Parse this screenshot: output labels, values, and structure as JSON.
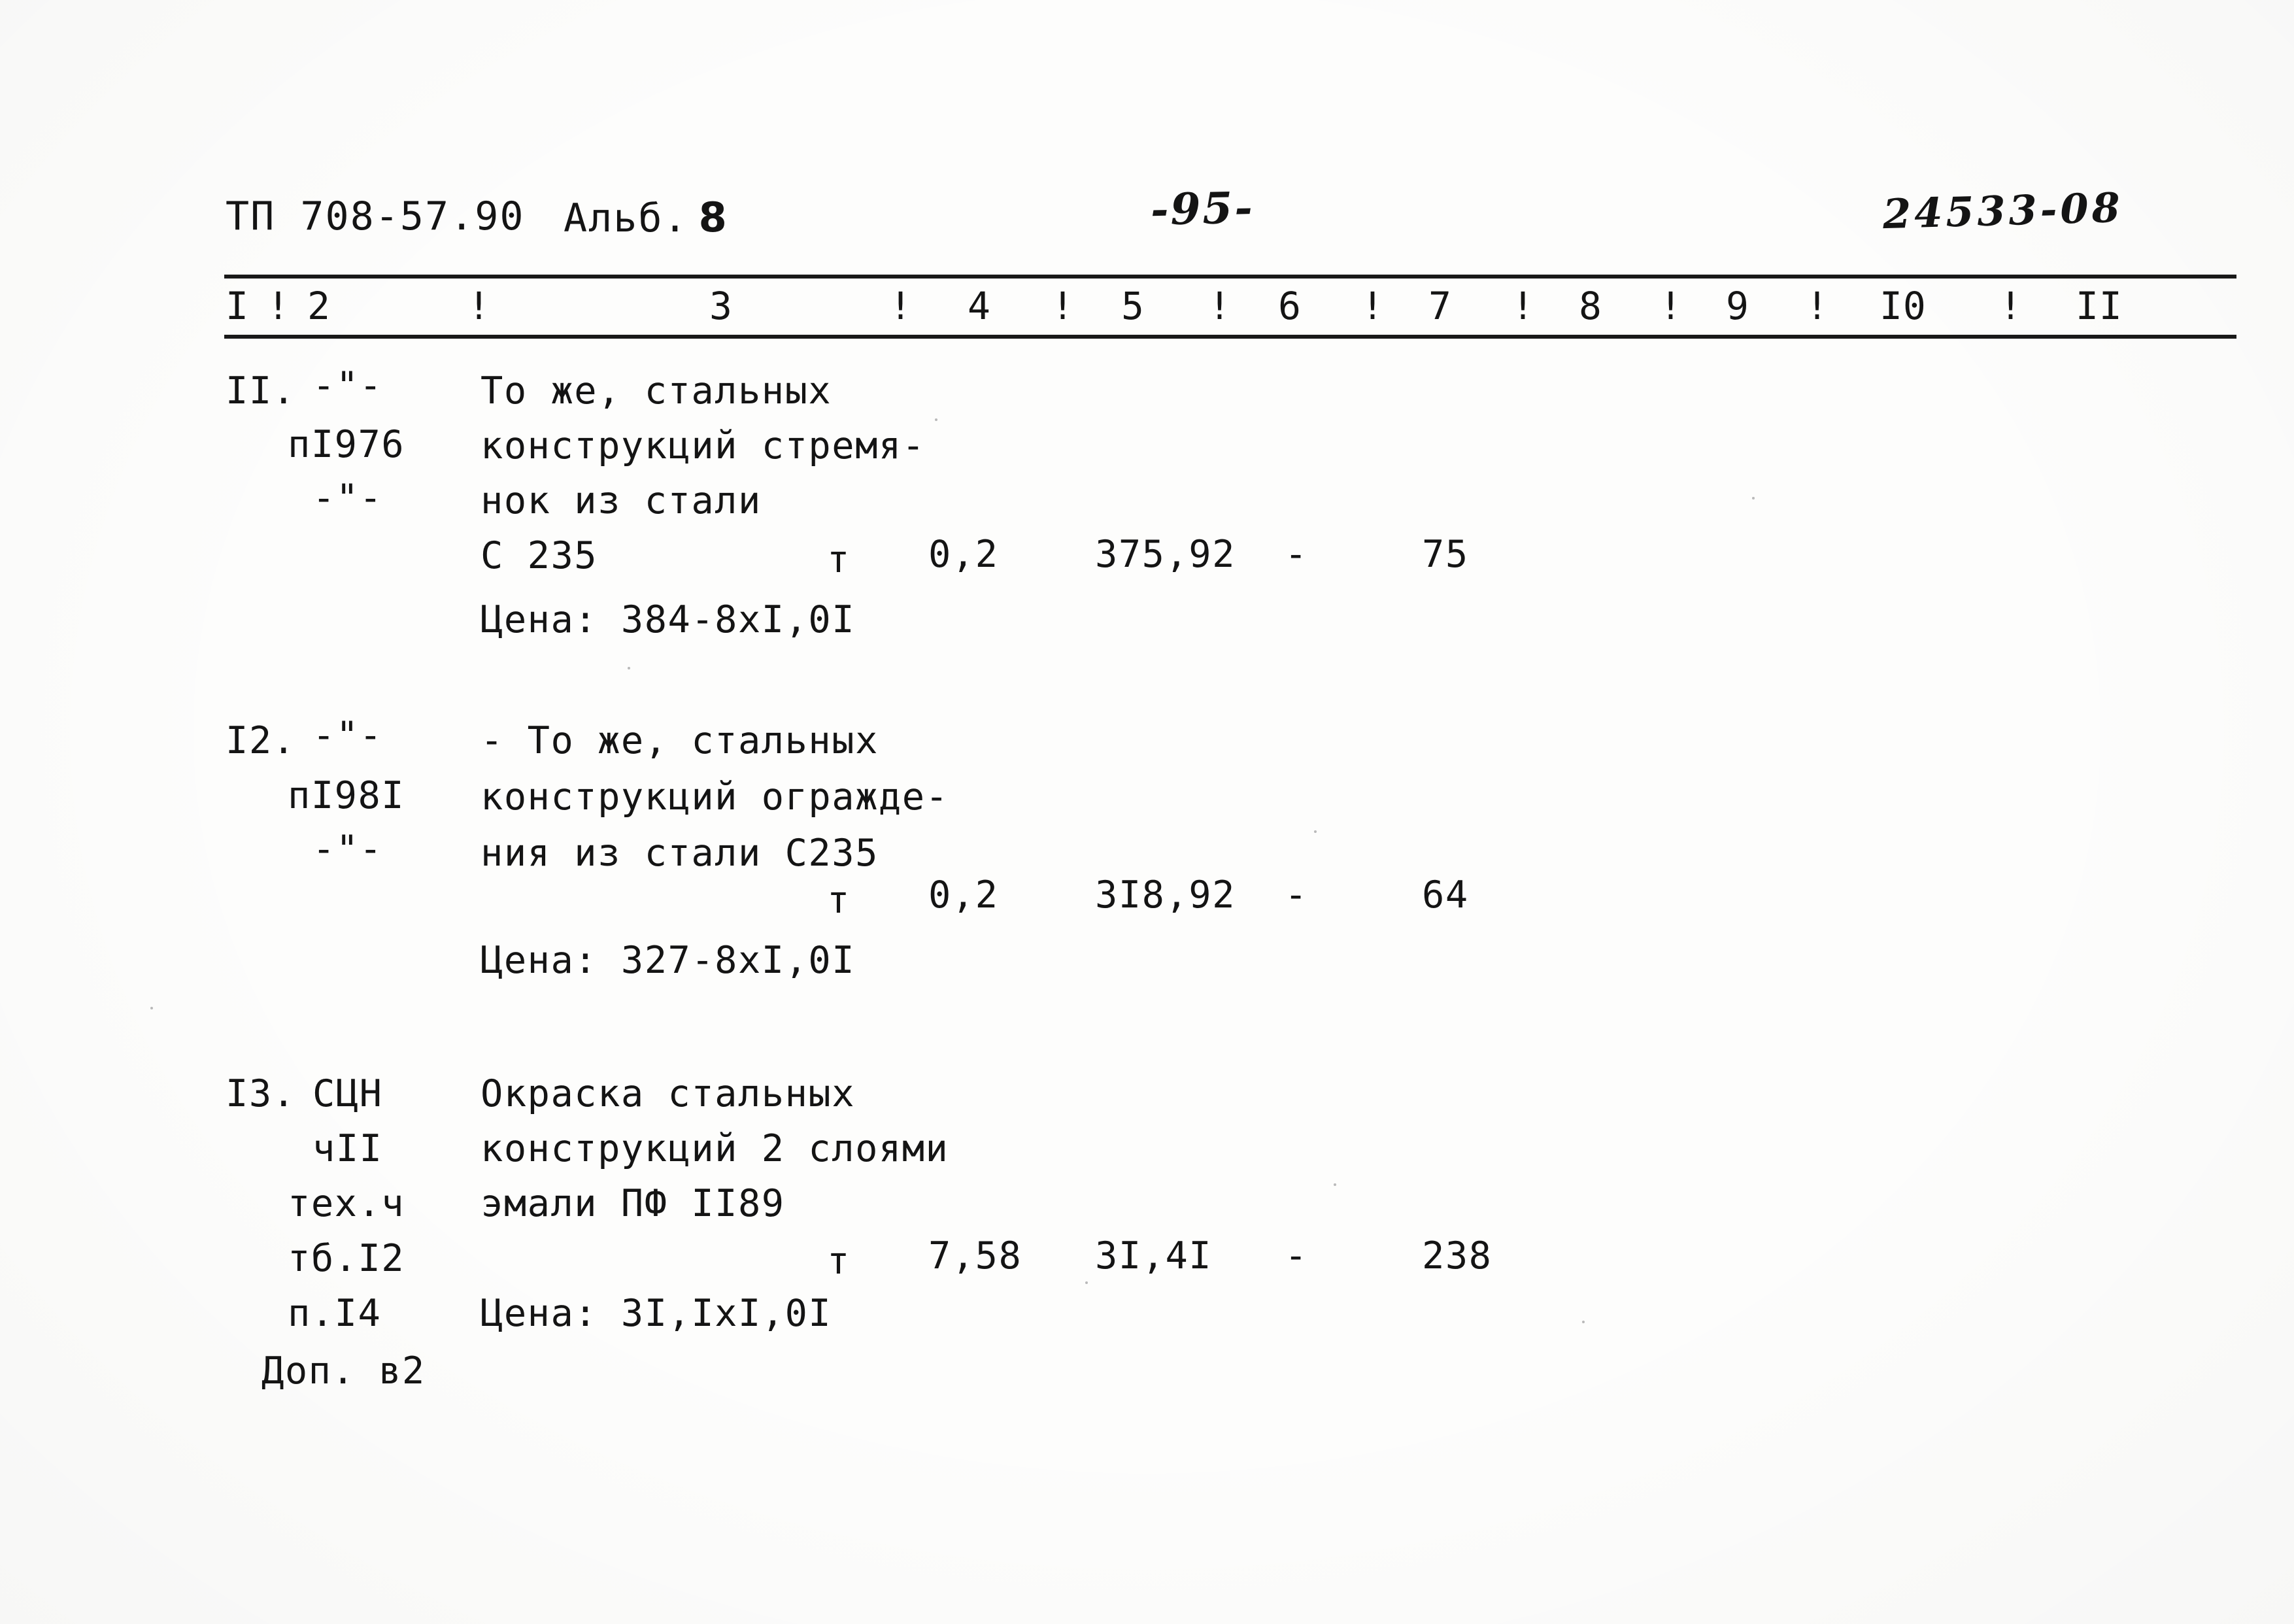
{
  "document": {
    "header": {
      "doc_code": "ТП 708-57.90",
      "album_label": "Альб.",
      "album_number": "8",
      "page_number": "-95-",
      "stamp_code": "24533-08"
    },
    "column_headers": {
      "numbers": [
        "I",
        "2",
        "3",
        "4",
        "5",
        "6",
        "7",
        "8",
        "9",
        "I0",
        "II"
      ],
      "separator": "!"
    },
    "rows": [
      {
        "item_number": "II.",
        "ref_lines": [
          "-\"-",
          "пI976",
          "-\"-"
        ],
        "description_lines": [
          "То же, стальных",
          "конструкций стремя-",
          "нок из стали",
          "С 235"
        ],
        "unit": "т",
        "quantity": "0,2",
        "unit_price": "375,92",
        "col6": "-",
        "total": "75",
        "price_note": "Цена: 384-8xI,0I"
      },
      {
        "item_number": "I2.",
        "ref_lines": [
          "-\"-",
          "пI98I",
          "-\"-"
        ],
        "description_lines": [
          "- То же, стальных",
          "конструкций огражде-",
          "ния из стали С235"
        ],
        "unit": "т",
        "quantity": "0,2",
        "unit_price": "3I8,92",
        "col6": "-",
        "total": "64",
        "price_note": "Цена: 327-8xI,0I"
      },
      {
        "item_number": "I3.",
        "ref_lines": [
          "СЦН",
          "чII",
          "тех.ч",
          "тб.I2",
          "п.I4",
          "Доп. в2"
        ],
        "description_lines": [
          "Окраска стальных",
          "конструкций 2 слоями",
          "эмали ПФ II89"
        ],
        "unit": "т",
        "quantity": "7,58",
        "unit_price": "3I,4I",
        "col6": "-",
        "total": "238",
        "price_note": "Цена: 3I,IxI,0I"
      }
    ]
  }
}
